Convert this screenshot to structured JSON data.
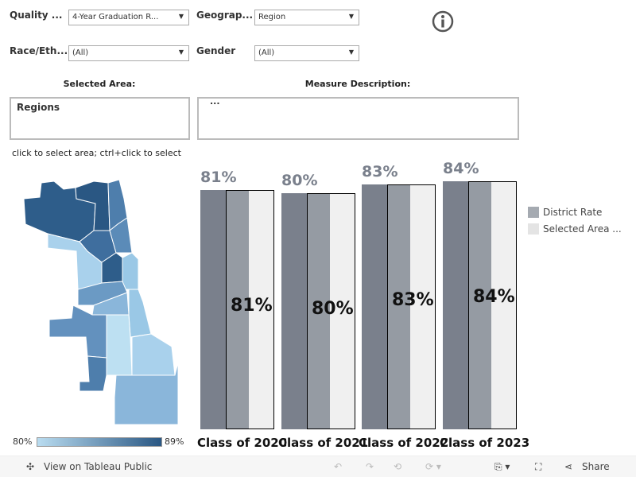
{
  "filters": {
    "quality": {
      "label": "Quality ...",
      "value": "4-Year Graduation R..."
    },
    "geography": {
      "label": "Geograp...",
      "value": "Region"
    },
    "race": {
      "label": "Race/Eth...",
      "value": "(All)"
    },
    "gender": {
      "label": "Gender",
      "value": "(All)"
    }
  },
  "info_icon": "info-circle-icon",
  "selected_area": {
    "header": "Selected Area:",
    "value": "Regions"
  },
  "measure": {
    "header": "Measure Description:",
    "value": "..."
  },
  "hint": "click to select area; ctrl+click to select",
  "map_legend": {
    "min": "80%",
    "max": "89%",
    "colors": [
      "#b9dcf0",
      "#2a5783"
    ]
  },
  "chart_data": {
    "type": "bar",
    "categories": [
      "Class of 2020",
      "Class of 2021",
      "Class of 2022",
      "Class of 2023"
    ],
    "series": [
      {
        "name": "District Rate",
        "values": [
          81,
          80,
          83,
          84
        ],
        "color": "#959ba3"
      },
      {
        "name": "Selected Area ...",
        "values": [
          81,
          80,
          83,
          84
        ],
        "color": "#f0f0f0"
      }
    ],
    "top_labels": [
      "81%",
      "80%",
      "83%",
      "84%"
    ],
    "inner_labels": [
      "81%",
      "80%",
      "83%",
      "84%"
    ],
    "ylim": [
      0,
      100
    ],
    "legend": "right",
    "background_bar_color": "#7a808c"
  },
  "toolbar": {
    "view": "View on Tableau Public",
    "share": "Share"
  }
}
